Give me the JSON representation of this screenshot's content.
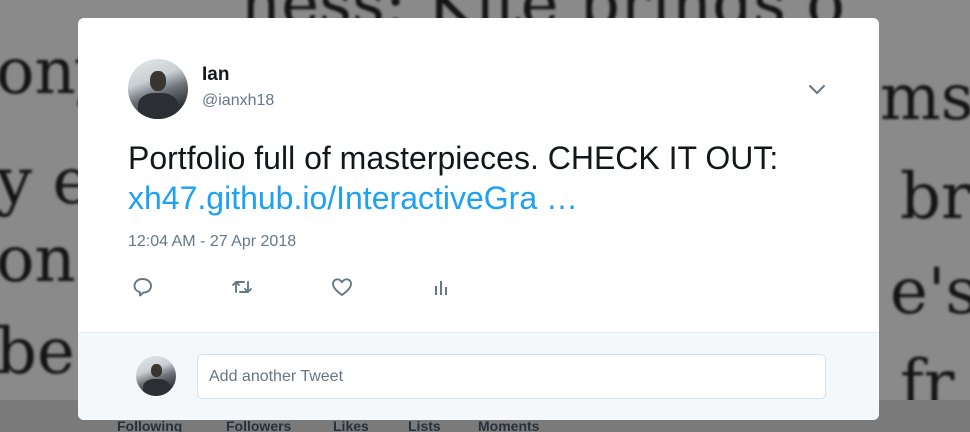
{
  "background": {
    "words": [
      "ness: Kite brings o",
      "ony",
      "ms,",
      "y e",
      "br",
      "on",
      "e's",
      "be",
      "fr"
    ],
    "nav": [
      "Following",
      "Followers",
      "Likes",
      "Lists",
      "Moments"
    ]
  },
  "tweet": {
    "author": {
      "name": "Ian",
      "handle": "@ianxh18",
      "avatar": "profile-photo"
    },
    "text": "Portfolio full of masterpieces. CHECK IT OUT:",
    "link": "xh47.github.io/InteractiveGra …",
    "timestamp": "12:04 AM - 27 Apr 2018",
    "menu_icon": "chevron-down-icon",
    "actions": [
      {
        "name": "reply",
        "icon": "reply-icon"
      },
      {
        "name": "retweet",
        "icon": "retweet-icon"
      },
      {
        "name": "like",
        "icon": "heart-icon"
      },
      {
        "name": "analytics",
        "icon": "analytics-icon"
      }
    ]
  },
  "composer": {
    "placeholder": "Add another Tweet"
  },
  "colors": {
    "link": "#1da1f2",
    "secondary_text": "#657786",
    "primary_text": "#14171a",
    "composer_bg": "#f5f8fa",
    "overlay": "#8a8a8a"
  }
}
